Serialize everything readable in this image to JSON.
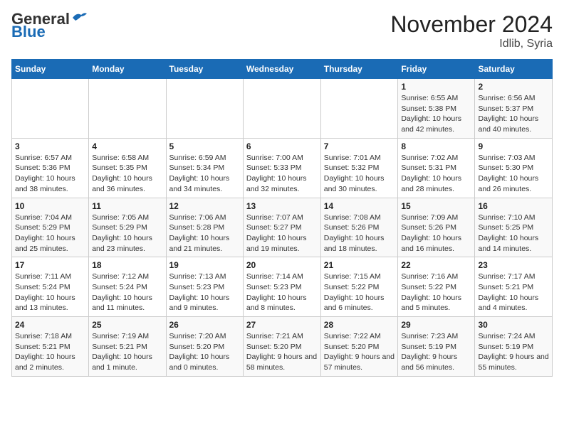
{
  "header": {
    "logo_line1": "General",
    "logo_line2": "Blue",
    "title": "November 2024",
    "subtitle": "Idlib, Syria"
  },
  "calendar": {
    "days_of_week": [
      "Sunday",
      "Monday",
      "Tuesday",
      "Wednesday",
      "Thursday",
      "Friday",
      "Saturday"
    ],
    "weeks": [
      [
        {
          "day": "",
          "info": ""
        },
        {
          "day": "",
          "info": ""
        },
        {
          "day": "",
          "info": ""
        },
        {
          "day": "",
          "info": ""
        },
        {
          "day": "",
          "info": ""
        },
        {
          "day": "1",
          "info": "Sunrise: 6:55 AM\nSunset: 5:38 PM\nDaylight: 10 hours and 42 minutes."
        },
        {
          "day": "2",
          "info": "Sunrise: 6:56 AM\nSunset: 5:37 PM\nDaylight: 10 hours and 40 minutes."
        }
      ],
      [
        {
          "day": "3",
          "info": "Sunrise: 6:57 AM\nSunset: 5:36 PM\nDaylight: 10 hours and 38 minutes."
        },
        {
          "day": "4",
          "info": "Sunrise: 6:58 AM\nSunset: 5:35 PM\nDaylight: 10 hours and 36 minutes."
        },
        {
          "day": "5",
          "info": "Sunrise: 6:59 AM\nSunset: 5:34 PM\nDaylight: 10 hours and 34 minutes."
        },
        {
          "day": "6",
          "info": "Sunrise: 7:00 AM\nSunset: 5:33 PM\nDaylight: 10 hours and 32 minutes."
        },
        {
          "day": "7",
          "info": "Sunrise: 7:01 AM\nSunset: 5:32 PM\nDaylight: 10 hours and 30 minutes."
        },
        {
          "day": "8",
          "info": "Sunrise: 7:02 AM\nSunset: 5:31 PM\nDaylight: 10 hours and 28 minutes."
        },
        {
          "day": "9",
          "info": "Sunrise: 7:03 AM\nSunset: 5:30 PM\nDaylight: 10 hours and 26 minutes."
        }
      ],
      [
        {
          "day": "10",
          "info": "Sunrise: 7:04 AM\nSunset: 5:29 PM\nDaylight: 10 hours and 25 minutes."
        },
        {
          "day": "11",
          "info": "Sunrise: 7:05 AM\nSunset: 5:29 PM\nDaylight: 10 hours and 23 minutes."
        },
        {
          "day": "12",
          "info": "Sunrise: 7:06 AM\nSunset: 5:28 PM\nDaylight: 10 hours and 21 minutes."
        },
        {
          "day": "13",
          "info": "Sunrise: 7:07 AM\nSunset: 5:27 PM\nDaylight: 10 hours and 19 minutes."
        },
        {
          "day": "14",
          "info": "Sunrise: 7:08 AM\nSunset: 5:26 PM\nDaylight: 10 hours and 18 minutes."
        },
        {
          "day": "15",
          "info": "Sunrise: 7:09 AM\nSunset: 5:26 PM\nDaylight: 10 hours and 16 minutes."
        },
        {
          "day": "16",
          "info": "Sunrise: 7:10 AM\nSunset: 5:25 PM\nDaylight: 10 hours and 14 minutes."
        }
      ],
      [
        {
          "day": "17",
          "info": "Sunrise: 7:11 AM\nSunset: 5:24 PM\nDaylight: 10 hours and 13 minutes."
        },
        {
          "day": "18",
          "info": "Sunrise: 7:12 AM\nSunset: 5:24 PM\nDaylight: 10 hours and 11 minutes."
        },
        {
          "day": "19",
          "info": "Sunrise: 7:13 AM\nSunset: 5:23 PM\nDaylight: 10 hours and 9 minutes."
        },
        {
          "day": "20",
          "info": "Sunrise: 7:14 AM\nSunset: 5:23 PM\nDaylight: 10 hours and 8 minutes."
        },
        {
          "day": "21",
          "info": "Sunrise: 7:15 AM\nSunset: 5:22 PM\nDaylight: 10 hours and 6 minutes."
        },
        {
          "day": "22",
          "info": "Sunrise: 7:16 AM\nSunset: 5:22 PM\nDaylight: 10 hours and 5 minutes."
        },
        {
          "day": "23",
          "info": "Sunrise: 7:17 AM\nSunset: 5:21 PM\nDaylight: 10 hours and 4 minutes."
        }
      ],
      [
        {
          "day": "24",
          "info": "Sunrise: 7:18 AM\nSunset: 5:21 PM\nDaylight: 10 hours and 2 minutes."
        },
        {
          "day": "25",
          "info": "Sunrise: 7:19 AM\nSunset: 5:21 PM\nDaylight: 10 hours and 1 minute."
        },
        {
          "day": "26",
          "info": "Sunrise: 7:20 AM\nSunset: 5:20 PM\nDaylight: 10 hours and 0 minutes."
        },
        {
          "day": "27",
          "info": "Sunrise: 7:21 AM\nSunset: 5:20 PM\nDaylight: 9 hours and 58 minutes."
        },
        {
          "day": "28",
          "info": "Sunrise: 7:22 AM\nSunset: 5:20 PM\nDaylight: 9 hours and 57 minutes."
        },
        {
          "day": "29",
          "info": "Sunrise: 7:23 AM\nSunset: 5:19 PM\nDaylight: 9 hours and 56 minutes."
        },
        {
          "day": "30",
          "info": "Sunrise: 7:24 AM\nSunset: 5:19 PM\nDaylight: 9 hours and 55 minutes."
        }
      ]
    ]
  }
}
